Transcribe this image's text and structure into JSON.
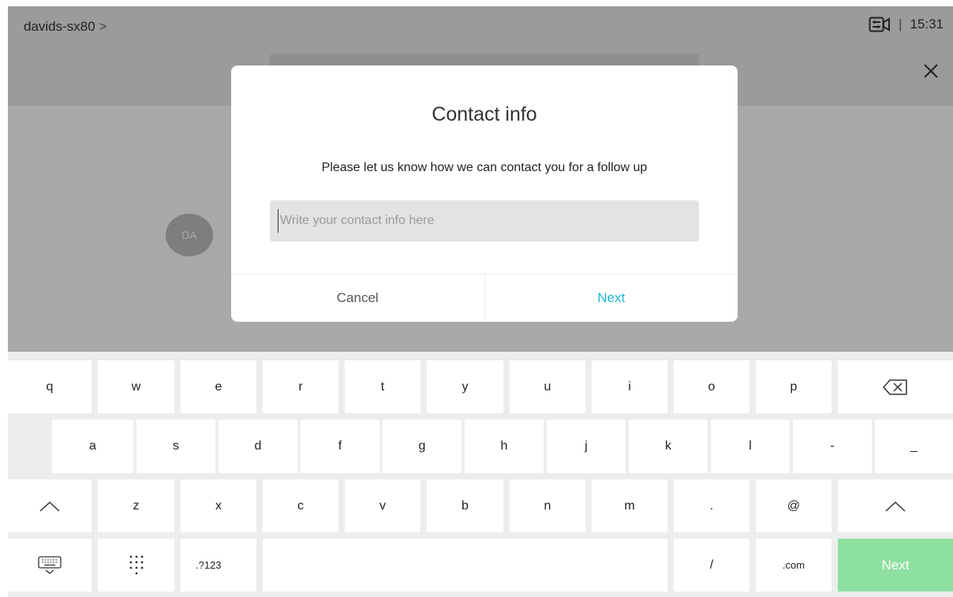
{
  "status": {
    "device_name": "davids-sx80",
    "device_chevron": ">",
    "time": "15:31",
    "icons": [
      "camera-settings-icon"
    ]
  },
  "header": {
    "close_icon": "close-icon"
  },
  "participant": {
    "avatar_initials": "DA"
  },
  "dialog": {
    "title": "Contact info",
    "message": "Please let us know how we can contact you for a follow up",
    "input_value": "",
    "input_placeholder": "Write your contact info here",
    "cancel_label": "Cancel",
    "next_label": "Next",
    "accent_color": "#1ab8d6"
  },
  "keyboard": {
    "row1": [
      "q",
      "w",
      "e",
      "r",
      "t",
      "y",
      "u",
      "i",
      "o",
      "p"
    ],
    "row2": [
      "a",
      "s",
      "d",
      "f",
      "g",
      "h",
      "j",
      "k",
      "l",
      "-",
      "_"
    ],
    "row3": [
      "z",
      "x",
      "c",
      "v",
      "b",
      "n",
      "m",
      ".",
      "@"
    ],
    "row4": {
      "hide_icon": "keyboard-hide-icon",
      "layout_icon": "keypad-icon",
      "symbols_label": ".?123",
      "slash_label": "/",
      "com_label": ".com",
      "next_label": "Next",
      "next_color": "#8de0a0"
    },
    "backspace_icon": "backspace-icon",
    "shift_icon": "shift-icon"
  }
}
